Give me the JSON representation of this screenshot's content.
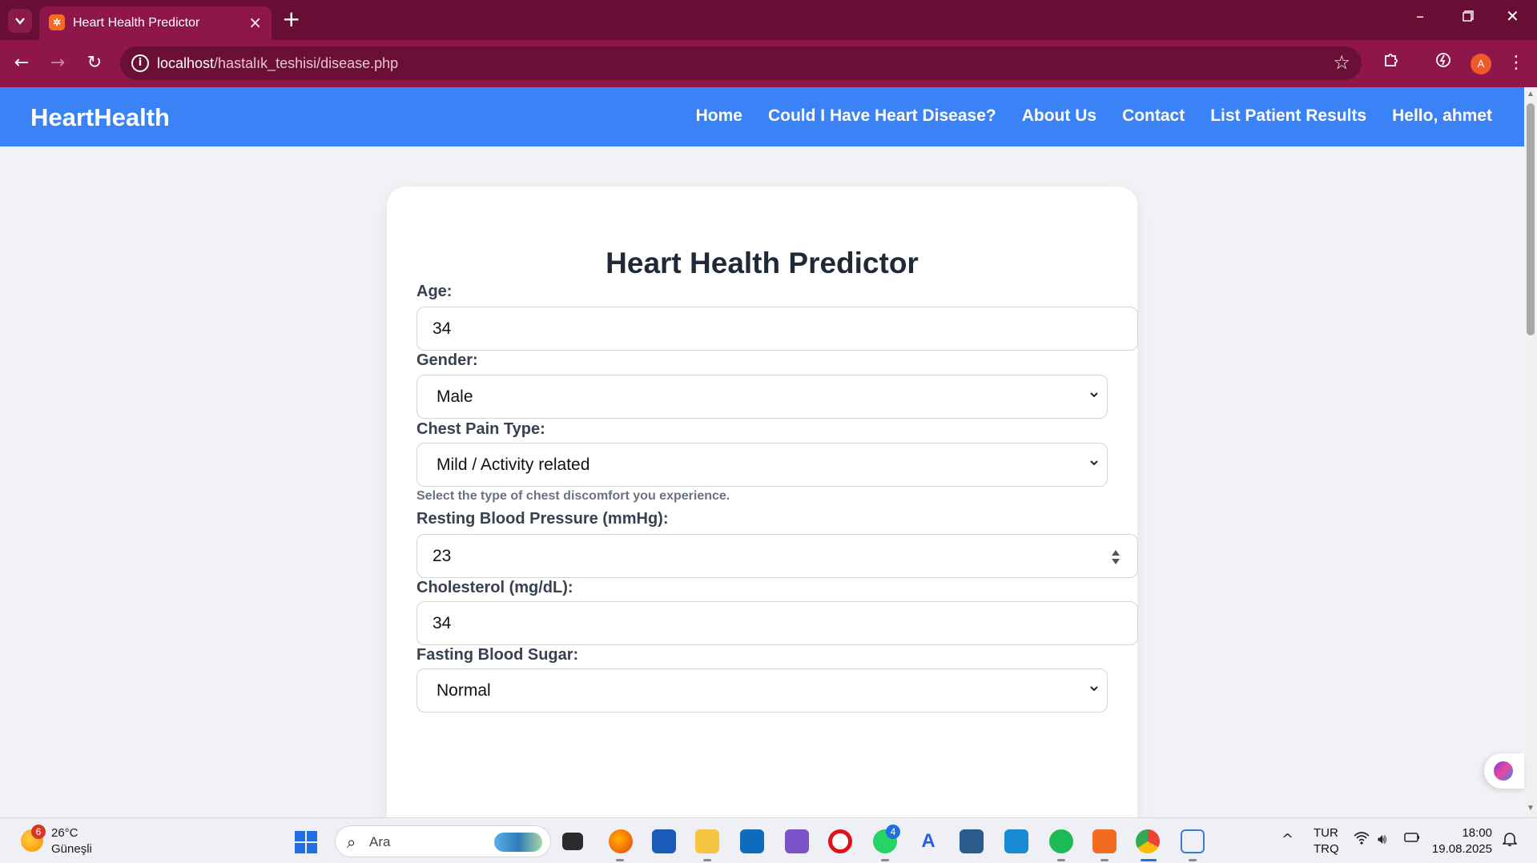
{
  "browser": {
    "tab_title": "Heart Health Predictor",
    "favicon_glyph": "✲",
    "url_host": "localhost",
    "url_path": "/hastalık_teshisi/disease.php",
    "profile_initial": "A"
  },
  "navbar": {
    "brand": "HeartHealth",
    "links": [
      "Home",
      "Could I Have Heart Disease?",
      "About Us",
      "Contact",
      "List Patient Results",
      "Hello, ahmet"
    ]
  },
  "form": {
    "title": "Heart Health Predictor",
    "age": {
      "label": "Age:",
      "value": "34"
    },
    "gender": {
      "label": "Gender:",
      "value": "Male"
    },
    "chest_pain": {
      "label": "Chest Pain Type:",
      "value": "Mild / Activity related",
      "help": "Select the type of chest discomfort you experience."
    },
    "resting_bp": {
      "label": "Resting Blood Pressure (mmHg):",
      "value": "23"
    },
    "cholesterol": {
      "label": "Cholesterol (mg/dL):",
      "value": "34"
    },
    "fasting_sugar": {
      "label": "Fasting Blood Sugar:",
      "value": "Normal"
    }
  },
  "taskbar": {
    "weather_temp": "26°C",
    "weather_desc": "Güneşli",
    "weather_badge": "6",
    "search_placeholder": "Ara",
    "whatsapp_badge": "4",
    "lang_top": "TUR",
    "lang_bottom": "TRQ",
    "time": "18:00",
    "date": "19.08.2025"
  },
  "colors": {
    "tabbar": "#680e35",
    "toolbar": "#8e164a",
    "navbar": "#3b82f6",
    "page_bg": "#f0f2f5"
  }
}
